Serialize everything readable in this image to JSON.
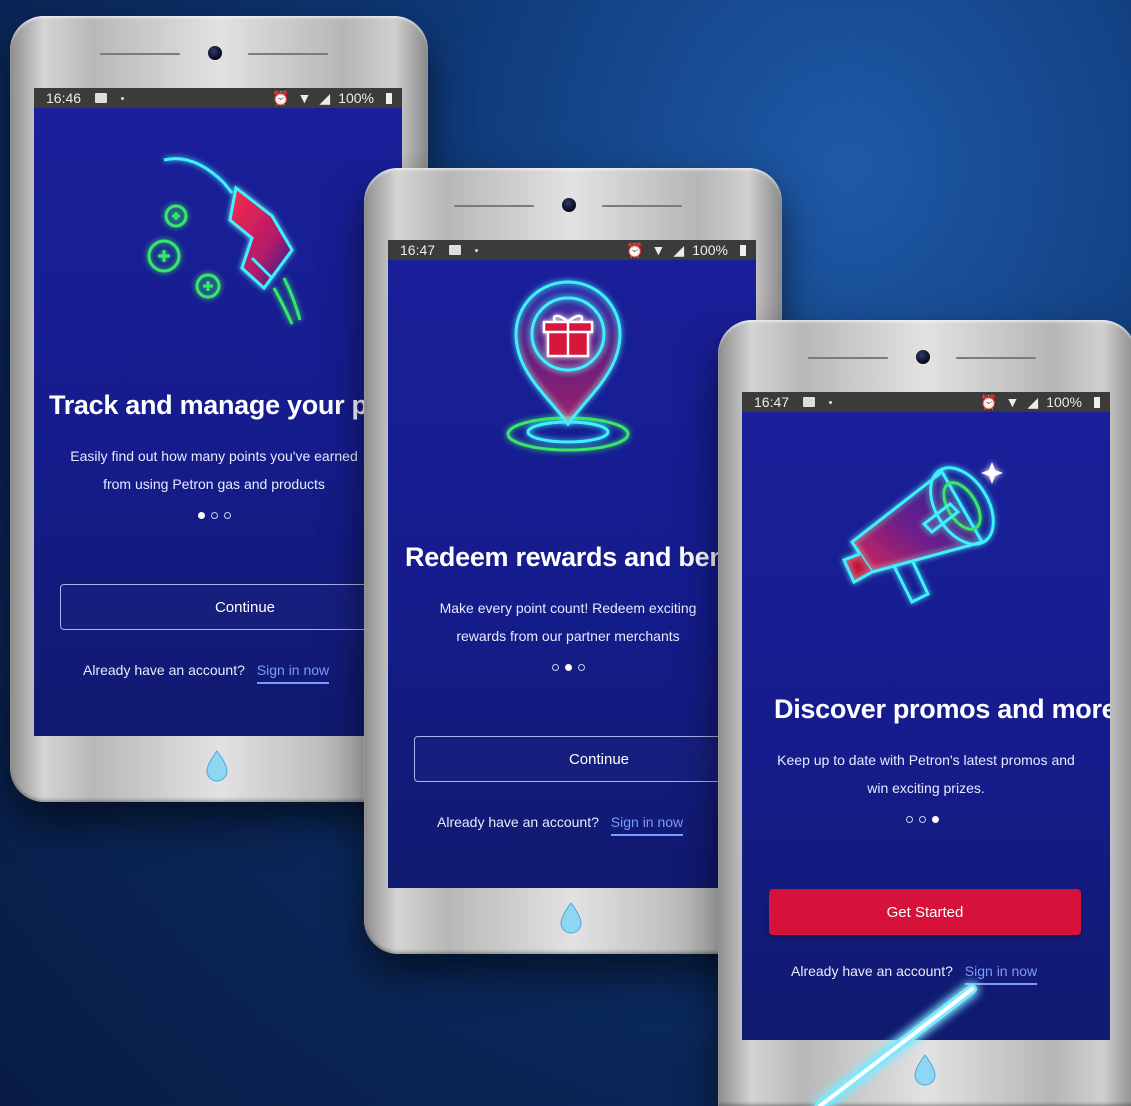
{
  "phones": [
    {
      "status_time": "16:46",
      "battery": "100%",
      "title": "Track and manage your points",
      "desc_line1": "Easily find out how many points you've earned",
      "desc_line2": "from using Petron gas and products",
      "active_dot": 0,
      "button_label": "Continue",
      "signin_prompt": "Already have an account?",
      "signin_link": "Sign in now",
      "illustration": "fuel-nozzle-icon"
    },
    {
      "status_time": "16:47",
      "battery": "100%",
      "title": "Redeem rewards and benefits",
      "desc_line1": "Make every point count! Redeem exciting",
      "desc_line2": "rewards from our partner merchants",
      "active_dot": 1,
      "button_label": "Continue",
      "signin_prompt": "Already have an account?",
      "signin_link": "Sign in now",
      "illustration": "gift-location-pin-icon"
    },
    {
      "status_time": "16:47",
      "battery": "100%",
      "title": "Discover promos and more",
      "desc_line1": "Keep up to date with Petron's latest promos and",
      "desc_line2": "win exciting prizes.",
      "active_dot": 2,
      "button_label": "Get Started",
      "signin_prompt": "Already have an account?",
      "signin_link": "Sign in now",
      "illustration": "megaphone-icon"
    }
  ],
  "colors": {
    "background": "#0e3876",
    "screen": "#161c8e",
    "primary_button": "#d6123a",
    "link": "#7c9bff",
    "neon_cyan": "#3ff0ff",
    "neon_green": "#39e66a",
    "neon_red": "#ff2a4a"
  }
}
